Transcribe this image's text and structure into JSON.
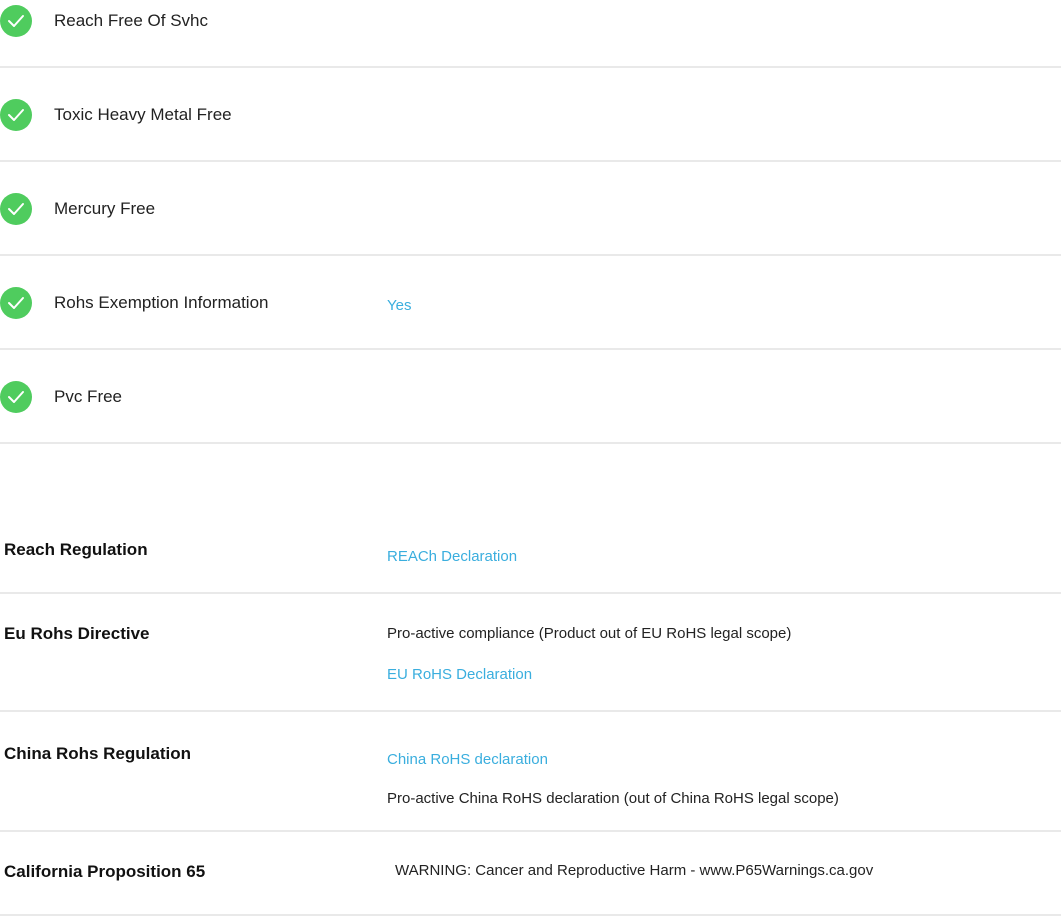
{
  "environmental": {
    "items": [
      {
        "label": "Reach Free Of Svhc",
        "value": ""
      },
      {
        "label": "Toxic Heavy Metal Free",
        "value": ""
      },
      {
        "label": "Mercury Free",
        "value": ""
      },
      {
        "label": "Rohs Exemption Information",
        "value": "Yes"
      },
      {
        "label": "Pvc Free",
        "value": ""
      }
    ]
  },
  "regulations": {
    "reach": {
      "label": "Reach Regulation",
      "link": "REACh Declaration"
    },
    "eu_rohs": {
      "label": "Eu Rohs Directive",
      "text": "Pro-active compliance (Product out of EU RoHS legal scope)",
      "link": "EU RoHS Declaration"
    },
    "china_rohs": {
      "label": "China Rohs Regulation",
      "link": "China RoHS declaration",
      "text": "Pro-active China RoHS declaration (out of China RoHS legal scope)"
    },
    "prop65": {
      "label": "California Proposition 65",
      "text": "WARNING: Cancer and Reproductive Harm - www.P65Warnings.ca.gov"
    }
  },
  "colors": {
    "check": "#4fcc5e",
    "link": "#3aaede",
    "divider": "#e9e9e9"
  }
}
